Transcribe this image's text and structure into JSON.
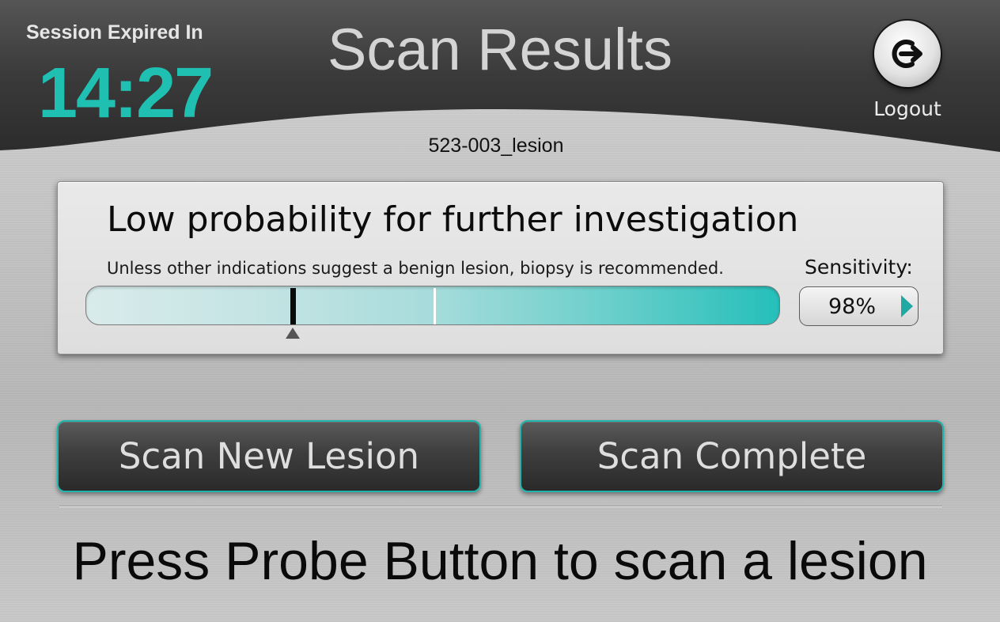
{
  "header": {
    "session_label": "Session Expired In",
    "session_time": "14:27",
    "title": "Scan Results",
    "logout_label": "Logout",
    "logout_icon": "logout-arrow-icon"
  },
  "scan": {
    "id": "523-003_lesion"
  },
  "result": {
    "heading": "Low probability for further investigation",
    "subtext": "Unless other indications suggest a benign lesion, biopsy is recommended.",
    "probability_score": 0.297,
    "threshold": 0.5,
    "sensitivity_label": "Sensitivity:",
    "sensitivity_value": "98%"
  },
  "actions": {
    "scan_new_label": "Scan New Lesion",
    "scan_complete_label": "Scan Complete"
  },
  "footer": {
    "instruction": "Press Probe Button to scan a lesion"
  },
  "colors": {
    "accent": "#1fbfb2",
    "header_dark": "#3a3a3a",
    "button_dark": "#3e3e3e"
  }
}
